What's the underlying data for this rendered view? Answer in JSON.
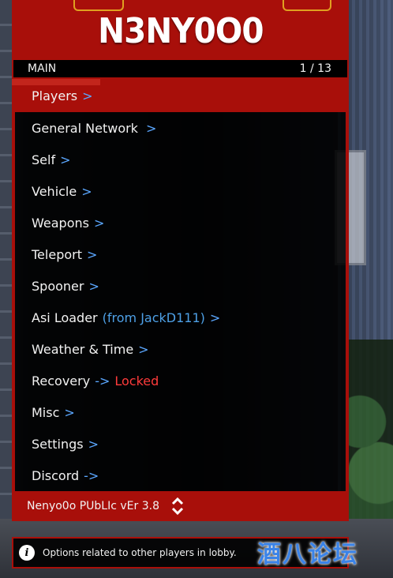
{
  "header": {
    "title": "N3NY0O0"
  },
  "subheader": {
    "section": "MAIN",
    "page": "1 / 13"
  },
  "menu_items": [
    {
      "label": "Players",
      "arrow": ">"
    },
    {
      "label": "General Network",
      "arrow": ">"
    },
    {
      "label": "Self",
      "arrow": ">"
    },
    {
      "label": "Vehicle",
      "arrow": ">"
    },
    {
      "label": "Weapons",
      "arrow": ">"
    },
    {
      "label": "Teleport",
      "arrow": ">"
    },
    {
      "label": "Spooner",
      "arrow": ">"
    },
    {
      "label": "Asi Loader",
      "note": "(from JackD111)",
      "arrow": ">"
    },
    {
      "label": "Weather & Time",
      "arrow": ">"
    },
    {
      "label": "Recovery",
      "arrow": "->",
      "status": "Locked"
    },
    {
      "label": "Misc",
      "arrow": ">"
    },
    {
      "label": "Settings",
      "arrow": ">"
    },
    {
      "label": "Discord",
      "arrow": "->"
    }
  ],
  "selected_index": 0,
  "footer": {
    "version": "Nenyo0o PUbLIc vEr 3.8",
    "icon": "scroll-updown-icon"
  },
  "info": {
    "icon": "info-icon",
    "text": "Options related to other players in lobby."
  },
  "watermark": {
    "text": "酒八论坛"
  },
  "colors": {
    "accent": "#a80f0a",
    "link": "#5ba7ff",
    "locked": "#ff3b3b"
  }
}
